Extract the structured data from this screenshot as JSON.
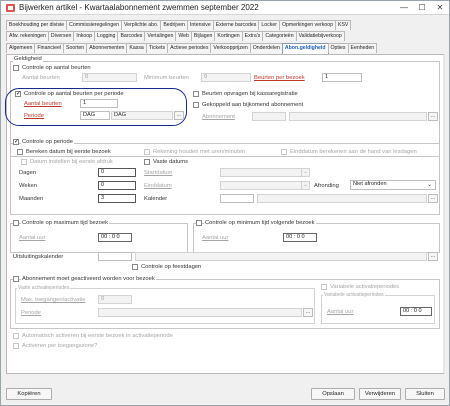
{
  "window": {
    "title": "Bijwerken artikel - Kwartaalabonnement zwemmen september 2022",
    "minimize": "—",
    "maximize": "☐",
    "close": "✕"
  },
  "tabs": {
    "row1": [
      "Boekhouding per divisie",
      "Commissieregelingen",
      "Verplichte abo.",
      "Bedrijven",
      "Intensive",
      "Externe barcodes",
      "Locker",
      "Opmerkingen verkoop",
      "KSV"
    ],
    "row2": [
      "Afw. rekeningen",
      "Diversen",
      "Inkoop",
      "Logging",
      "Barcodes",
      "Vertalingen",
      "Web",
      "Bijlagen",
      "Kortingen",
      "Extra's",
      "Categorieën",
      "Validatiebijverkoop"
    ],
    "row3": [
      "Algemeen",
      "Financieel",
      "Soorten",
      "Abonnementen",
      "Kassa",
      "Tickets",
      "Actieve periodes",
      "Verkoopprijzen",
      "Onderdelen",
      "Abon.geldigheid",
      "Opties",
      "Eenheden"
    ],
    "active": "Abon.geldigheid"
  },
  "geldigheid": {
    "section_label": "Geldigheid",
    "controle_aantal_beurten": "Controle op aantal beurten",
    "aantal_beurten_label": "Aantal beurten",
    "aantal_beurten_value": "0",
    "minimum_beurten_label": "Minimum beurten",
    "minimum_beurten_value": "0",
    "beurten_per_bezoek_label": "Beurten per bezoek",
    "beurten_per_bezoek_value": "1",
    "controle_per_periode": "Controle op aantal beurten per periode",
    "aantal_beurten2_label": "Aantal beurten",
    "aantal_beurten2_value": "1",
    "periode_label": "Periode",
    "periode_value1": "DAG",
    "periode_value2": "DAG",
    "beurten_opvragen": "Beurten opvragen bij kassaregistratie",
    "gekoppeld": "Gekoppeld aan bijkomend abonnement",
    "abonnement_label": "Abonnement"
  },
  "periode": {
    "controle_op_periode": "Controle op periode",
    "bereken_datum": "Bereken datum bij eerste bezoek",
    "rekening_houden": "Rekening houden met uren/minuten",
    "einddatum_bereken": "Einddatum berekenen aan de hand van lesdagen",
    "datum_instellen": "Datum instellen bij eerste afdruk",
    "vaste_datums": "Vaste datums",
    "dagen_label": "Dagen",
    "dagen_value": "0",
    "weken_label": "Weken",
    "weken_value": "0",
    "maanden_label": "Maanden",
    "maanden_value": "3",
    "startdatum_label": "Startdatum",
    "einddatum_label": "Einddatum",
    "kalender_label": "Kalender",
    "afronding_label": "Afronding",
    "afronding_value": "Niet afronden"
  },
  "tijd": {
    "max_bezoek": "Controle op maximum tijd bezoek",
    "aantal_uur_label": "Aantal uur",
    "aantal_uur_value": "00 : 0 0",
    "min_volgende": "Controle op minimum tijd volgende bezoek",
    "aantal_uur2_label": "Aantal uur",
    "aantal_uur2_value": "00 : 0 0"
  },
  "uitsluiting": {
    "label": "Uitsluitingskalender",
    "feestdagen": "Controle op feestdagen"
  },
  "activering": {
    "moet_geactiveerd": "Abonnement moet geactiveerd worden voor bezoek",
    "vaste_activatieperiodes": "Vaste activatieperiodes",
    "max_toegangen_label": "Max. toegangen/activatie",
    "max_toegangen_value": "0",
    "periode_label": "Periode",
    "variabele_activatieperiodes": "Variabele activatieperiodes",
    "variabele_group": "Variabele activatieperiodes",
    "aantal_uur_label": "Aantal uur",
    "aantal_uur_value": "00 : 0 0",
    "automatisch": "Automatisch activeren bij eerste bezoek in activatieperiode",
    "activeren_per_toegang": "Activeren per toegangszone?"
  },
  "footer": {
    "kopieren": "Kopiëren",
    "opslaan": "Opslaan",
    "verwijderen": "Verwijderen",
    "sluiten": "Sluiten"
  },
  "colors": {
    "accent": "#1a5fb4",
    "red_label": "#c0392b",
    "highlight": "#1a2a8a"
  }
}
